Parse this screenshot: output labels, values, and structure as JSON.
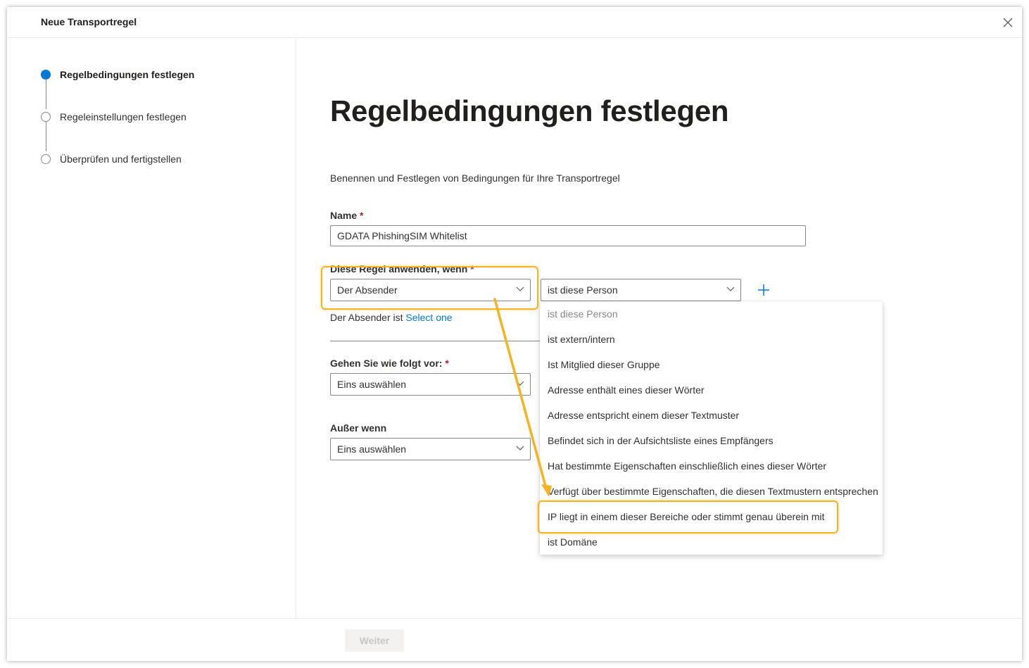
{
  "dialog": {
    "title": "Neue Transportregel"
  },
  "steps": [
    {
      "label": "Regelbedingungen festlegen",
      "state": "active"
    },
    {
      "label": "Regeleinstellungen festlegen",
      "state": "inactive"
    },
    {
      "label": "Überprüfen und fertigstellen",
      "state": "inactive"
    }
  ],
  "main": {
    "title": "Regelbedingungen festlegen",
    "description": "Benennen und Festlegen von Bedingungen für Ihre Transportregel",
    "name_label": "Name",
    "name_value": "GDATA PhishingSIM Whitelist",
    "required_mark": "*",
    "apply_label": "Diese Regel anwenden, wenn",
    "condition_select": "Der Absender",
    "predicate_select": "ist diese Person",
    "hint_text": "Der Absender ist",
    "hint_link": "Select one",
    "action_label": "Gehen Sie wie folgt vor:",
    "action_select": "Eins auswählen",
    "except_label": "Außer wenn",
    "except_select": "Eins auswählen"
  },
  "dropdown": {
    "items": [
      "ist diese Person",
      "ist extern/intern",
      "Ist Mitglied dieser Gruppe",
      "Adresse enthält eines dieser Wörter",
      "Adresse entspricht einem dieser Textmuster",
      "Befindet sich in der Aufsichtsliste eines Empfängers",
      "Hat bestimmte Eigenschaften einschließlich eines dieser Wörter",
      "Verfügt über bestimmte Eigenschaften, die diesen Textmustern entsprechen",
      "IP liegt in einem dieser Bereiche oder stimmt genau überein mit",
      "ist Domäne"
    ]
  },
  "footer": {
    "next_label": "Weiter"
  },
  "colors": {
    "accent": "#0078d4",
    "highlight": "#f5b324",
    "required": "#a4262c"
  }
}
